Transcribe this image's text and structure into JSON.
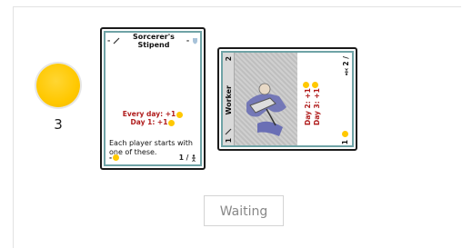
{
  "player": {
    "gold": "3",
    "colors": {
      "coin": "#ffc800"
    }
  },
  "cards": [
    {
      "cost": "-",
      "title": "Sorcerer's Stipend",
      "top_right": "-",
      "effect_line1": "Every day: +1",
      "effect_line2": "Day 1: +1",
      "description": "Each player starts with one of these.",
      "footer_left": "-",
      "footer_right": "1 /"
    },
    {
      "title": "Worker",
      "top_left_number": "2",
      "bottom_left_number": "1",
      "effect_line1": "Day 2: +1",
      "effect_line2": "Day 3: +1",
      "top_right": "2 /",
      "bottom_right": "1"
    }
  ],
  "status": {
    "waiting_label": "Waiting"
  }
}
